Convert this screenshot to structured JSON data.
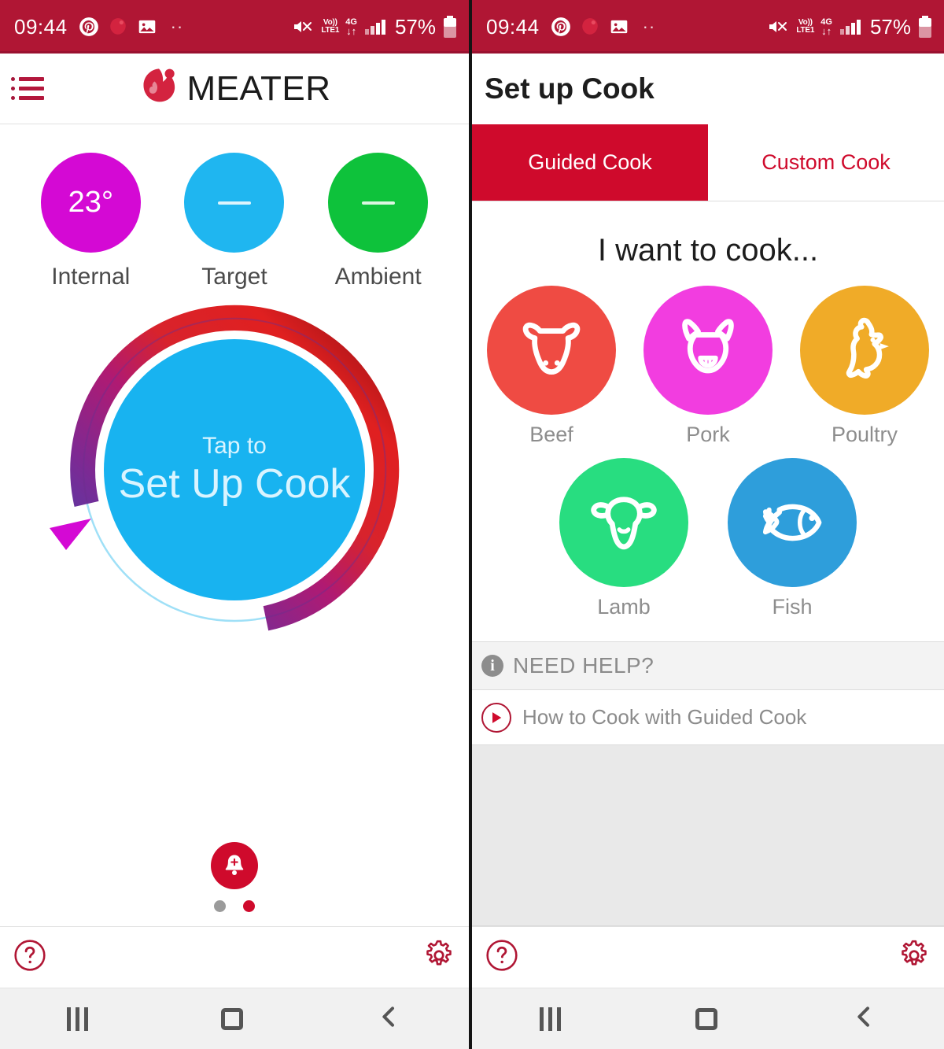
{
  "status_bar": {
    "time": "09:44",
    "left_icons": [
      "pinterest-icon",
      "meater-icon",
      "gallery-icon",
      "overflow-dots"
    ],
    "overflow": "··",
    "volte_top": "Vo))",
    "volte_bottom": "LTE1",
    "network": "4G",
    "data_arrows": "↓↑",
    "battery_percent": "57%",
    "background": "#b01634"
  },
  "left_screen": {
    "header": {
      "menu_label": "menu",
      "brand": "MEATER"
    },
    "temperatures": [
      {
        "label": "Internal",
        "value": "23°",
        "color": "#d409d4",
        "has_value": true
      },
      {
        "label": "Target",
        "value": "—",
        "color": "#1fb6f0",
        "has_value": false
      },
      {
        "label": "Ambient",
        "value": "—",
        "color": "#0ec23b",
        "has_value": false
      }
    ],
    "dial": {
      "tap_text": "Tap to",
      "title": "Set Up Cook",
      "center_color": "#18b3f0",
      "arc_start_color": "#3f46b0",
      "arc_mid_color": "#b01a72",
      "arc_end_color": "#8f0f15",
      "pointer_color": "#d409d4"
    },
    "alarm_button": "add-alarm",
    "page_dots": [
      {
        "active": false
      },
      {
        "active": true
      }
    ],
    "toolbar": {
      "help_label": "?",
      "settings_label": "settings"
    }
  },
  "right_screen": {
    "title": "Set up Cook",
    "tabs": [
      {
        "label": "Guided Cook",
        "active": true
      },
      {
        "label": "Custom Cook",
        "active": false
      }
    ],
    "heading": "I want to cook...",
    "foods_row1": [
      {
        "label": "Beef",
        "color": "#ef4b43",
        "icon": "cow-icon"
      },
      {
        "label": "Pork",
        "color": "#f23de0",
        "icon": "pig-icon"
      },
      {
        "label": "Poultry",
        "color": "#f0ab28",
        "icon": "chicken-icon"
      }
    ],
    "foods_row2": [
      {
        "label": "Lamb",
        "color": "#28dd80",
        "icon": "sheep-icon"
      },
      {
        "label": "Fish",
        "color": "#2e9edb",
        "icon": "fish-icon"
      }
    ],
    "help": {
      "section_title": "NEED HELP?",
      "row_label": "How to Cook with Guided Cook"
    },
    "toolbar": {
      "help_label": "?",
      "settings_label": "settings"
    }
  },
  "nav_bar": {
    "recents": "recents",
    "home": "home",
    "back": "back"
  },
  "colors": {
    "brand_red": "#cf0a2c",
    "status_bar": "#b01634",
    "accent_blue": "#18b3f0"
  }
}
